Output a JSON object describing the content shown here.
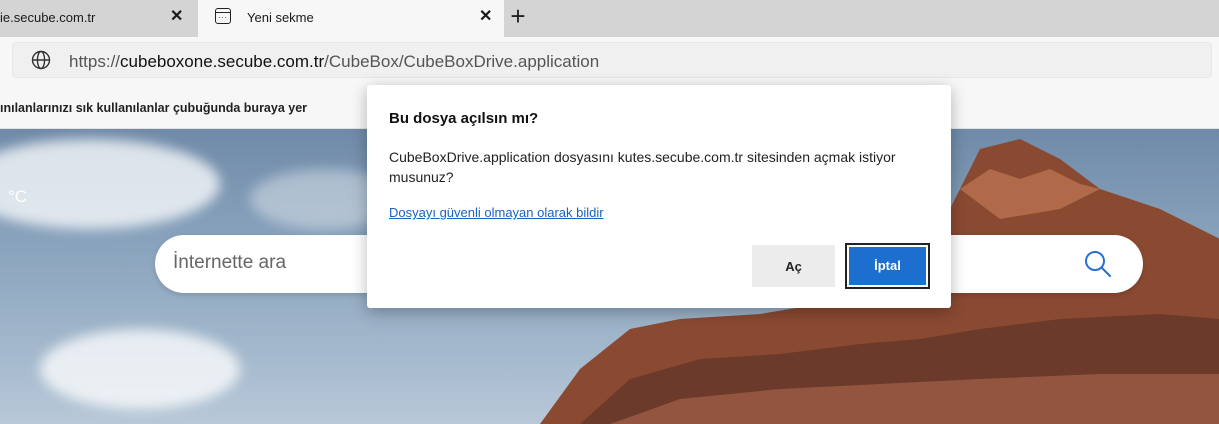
{
  "tabs": [
    {
      "title": "ie.secube.com.tr",
      "close_icon": "close-icon"
    },
    {
      "title": "Yeni sekme",
      "icon": "new-tab-page-icon",
      "close_icon": "close-icon"
    }
  ],
  "new_tab_label": "+",
  "address_bar": {
    "prefix": "https://",
    "host": "cubeboxone.secube.com.tr",
    "path": "/CubeBox/CubeBoxDrive.application",
    "icon": "globe-icon"
  },
  "favorites_bar": {
    "text": "ınılanlarınızı sık kullanılanlar çubuğunda buraya yer"
  },
  "page": {
    "temperature": "°C",
    "search_placeholder": "İnternette ara",
    "search_icon": "search-icon"
  },
  "dialog": {
    "title": "Bu dosya açılsın mı?",
    "message": "CubeBoxDrive.application dosyasını kutes.secube.com.tr sitesinden açmak istiyor musunuz?",
    "report_link": "Dosyayı güvenli olmayan olarak bildir",
    "open_button": "Aç",
    "cancel_button": "İptal"
  },
  "colors": {
    "accent": "#1d6fcf",
    "link": "#1862c4",
    "tabstrip": "#d4d4d4"
  }
}
